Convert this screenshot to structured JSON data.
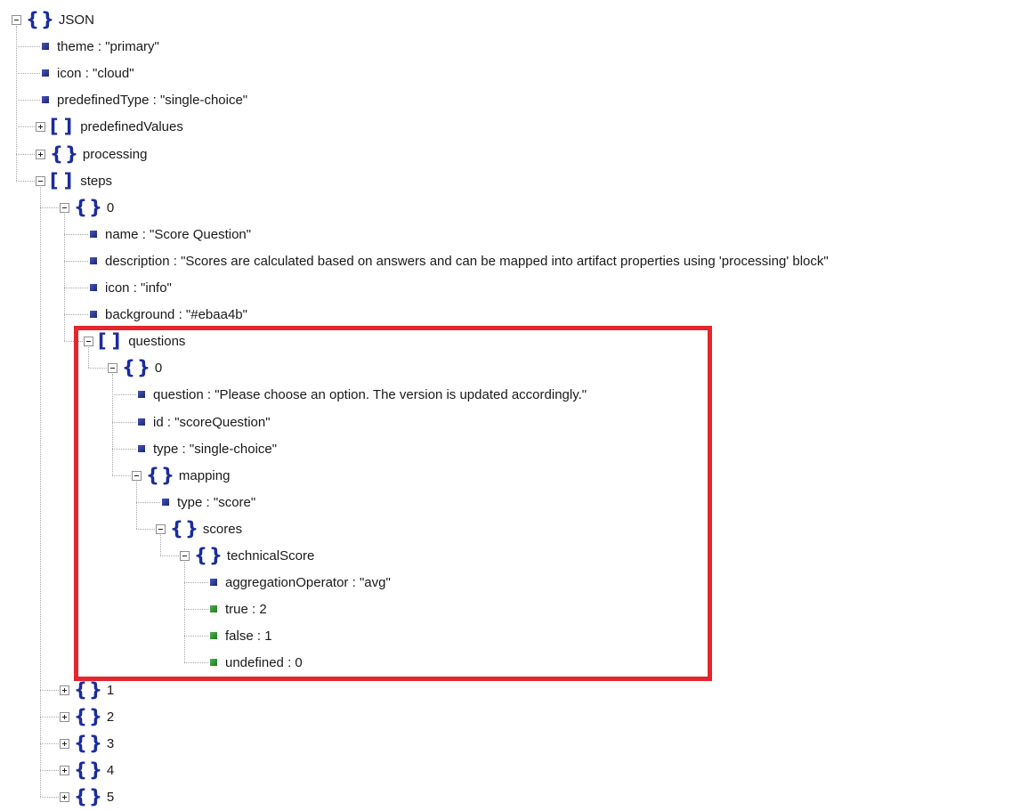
{
  "tree": [
    {
      "id": "root",
      "d": 0,
      "kind": "object",
      "open": true,
      "label": "JSON"
    },
    {
      "id": "theme",
      "d": 1,
      "kind": "leaf",
      "key": "theme",
      "value": "\"primary\""
    },
    {
      "id": "icon",
      "d": 1,
      "kind": "leaf",
      "key": "icon",
      "value": "\"cloud\""
    },
    {
      "id": "predefinedType",
      "d": 1,
      "kind": "leaf",
      "key": "predefinedType",
      "value": "\"single-choice\""
    },
    {
      "id": "predefinedValues",
      "d": 1,
      "kind": "array",
      "open": false,
      "label": "predefinedValues"
    },
    {
      "id": "processing",
      "d": 1,
      "kind": "object",
      "open": false,
      "label": "processing"
    },
    {
      "id": "steps",
      "d": 1,
      "kind": "array",
      "open": true,
      "label": "steps"
    },
    {
      "id": "steps-0",
      "d": 2,
      "kind": "object",
      "open": true,
      "label": "0"
    },
    {
      "id": "steps-0-name",
      "d": 3,
      "kind": "leaf",
      "key": "name",
      "value": "\"Score Question\""
    },
    {
      "id": "steps-0-description",
      "d": 3,
      "kind": "leaf",
      "key": "description",
      "value": "\"Scores are calculated based on answers and can be mapped into artifact properties using 'processing' block\""
    },
    {
      "id": "steps-0-icon",
      "d": 3,
      "kind": "leaf",
      "key": "icon",
      "value": "\"info\""
    },
    {
      "id": "steps-0-background",
      "d": 3,
      "kind": "leaf",
      "key": "background",
      "value": "\"#ebaa4b\""
    },
    {
      "id": "questions",
      "d": 3,
      "kind": "array",
      "open": true,
      "label": "questions"
    },
    {
      "id": "questions-0",
      "d": 4,
      "kind": "object",
      "open": true,
      "label": "0"
    },
    {
      "id": "q-question",
      "d": 5,
      "kind": "leaf",
      "key": "question",
      "value": "\"Please choose an option. The version is updated accordingly.\""
    },
    {
      "id": "q-id",
      "d": 5,
      "kind": "leaf",
      "key": "id",
      "value": "\"scoreQuestion\""
    },
    {
      "id": "q-type",
      "d": 5,
      "kind": "leaf",
      "key": "type",
      "value": "\"single-choice\""
    },
    {
      "id": "mapping",
      "d": 5,
      "kind": "object",
      "open": true,
      "label": "mapping"
    },
    {
      "id": "mapping-type",
      "d": 6,
      "kind": "leaf",
      "key": "type",
      "value": "\"score\""
    },
    {
      "id": "scores",
      "d": 6,
      "kind": "object",
      "open": true,
      "label": "scores"
    },
    {
      "id": "technicalScore",
      "d": 7,
      "kind": "object",
      "open": true,
      "label": "technicalScore"
    },
    {
      "id": "aggregationOperator",
      "d": 8,
      "kind": "leaf",
      "key": "aggregationOperator",
      "value": "\"avg\""
    },
    {
      "id": "ts-true",
      "d": 8,
      "kind": "leaf",
      "num": true,
      "key": "true",
      "value": "2"
    },
    {
      "id": "ts-false",
      "d": 8,
      "kind": "leaf",
      "num": true,
      "key": "false",
      "value": "1"
    },
    {
      "id": "ts-undefined",
      "d": 8,
      "kind": "leaf",
      "num": true,
      "key": "undefined",
      "value": "0"
    },
    {
      "id": "steps-1",
      "d": 2,
      "kind": "object",
      "open": false,
      "label": "1"
    },
    {
      "id": "steps-2",
      "d": 2,
      "kind": "object",
      "open": false,
      "label": "2"
    },
    {
      "id": "steps-3",
      "d": 2,
      "kind": "object",
      "open": false,
      "label": "3"
    },
    {
      "id": "steps-4",
      "d": 2,
      "kind": "object",
      "open": false,
      "label": "4"
    },
    {
      "id": "steps-5",
      "d": 2,
      "kind": "object",
      "open": false,
      "label": "5"
    }
  ],
  "highlight": {
    "color": "#e5262d",
    "from": "questions",
    "to": "ts-undefined"
  },
  "colors": {
    "bracket": "#1c2c9c",
    "string_leaf": "#1a2476",
    "number_leaf": "#1f7a1f"
  }
}
